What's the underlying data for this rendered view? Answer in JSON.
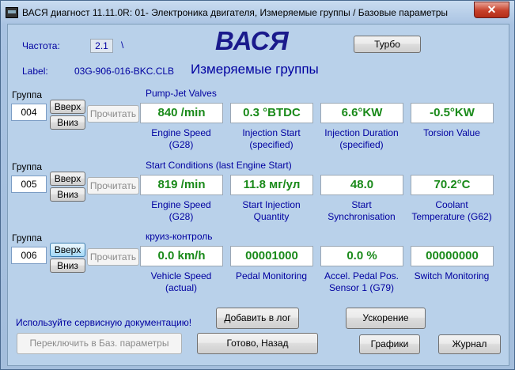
{
  "window": {
    "title": "ВАСЯ диагност 11.11.0R: 01- Электроника двигателя,  Измеряемые группы / Базовые параметры",
    "close": "✕"
  },
  "header": {
    "freq_label": "Частота:",
    "freq_value": "2.1",
    "freq_sep": "\\",
    "logo": "ВАСЯ",
    "label_label": "Label:",
    "label_value": "03G-906-016-BKC.CLB",
    "subtitle": "Измеряемые группы",
    "turbo": "Турбо"
  },
  "groups": [
    {
      "label": "Группа",
      "number": "004",
      "up": "Вверх",
      "down": "Вниз",
      "read": "Прочитать",
      "title": "Pump-Jet Valves",
      "values": [
        "840 /min",
        "0.3 °BTDC",
        "6.6°KW",
        "-0.5°KW"
      ],
      "captions": [
        "Engine Speed\n(G28)",
        "Injection Start\n(specified)",
        "Injection Duration\n(specified)",
        "Torsion Value"
      ]
    },
    {
      "label": "Группа",
      "number": "005",
      "up": "Вверх",
      "down": "Вниз",
      "read": "Прочитать",
      "title": "Start Conditions (last Engine Start)",
      "values": [
        "819 /min",
        "11.8 мг/ул",
        "48.0",
        "70.2°C"
      ],
      "captions": [
        "Engine Speed\n(G28)",
        "Start Injection\nQuantity",
        "Start\nSynchronisation",
        "Coolant\nTemperature (G62)"
      ]
    },
    {
      "label": "Группа",
      "number": "006",
      "up": "Вверх",
      "down": "Вниз",
      "read": "Прочитать",
      "title": "круиз-контроль",
      "values": [
        "0.0 km/h",
        "00001000",
        "0.0 %",
        "00000000"
      ],
      "captions": [
        "Vehicle Speed\n(actual)",
        "Pedal Monitoring",
        "Accel. Pedal Pos.\nSensor 1 (G79)",
        "Switch Monitoring"
      ]
    }
  ],
  "footer": {
    "doc_hint": "Используйте сервисную документацию!",
    "add_log": "Добавить в лог",
    "accel": "Ускорение",
    "switch_basic": "Переключить в Баз. параметры",
    "done": "Готово, Назад",
    "graphs": "Графики",
    "journal": "Журнал"
  },
  "colors": {
    "value_text": "#1a8a1a",
    "caption_text": "#0000a0",
    "logo_text": "#1a1a8c"
  }
}
